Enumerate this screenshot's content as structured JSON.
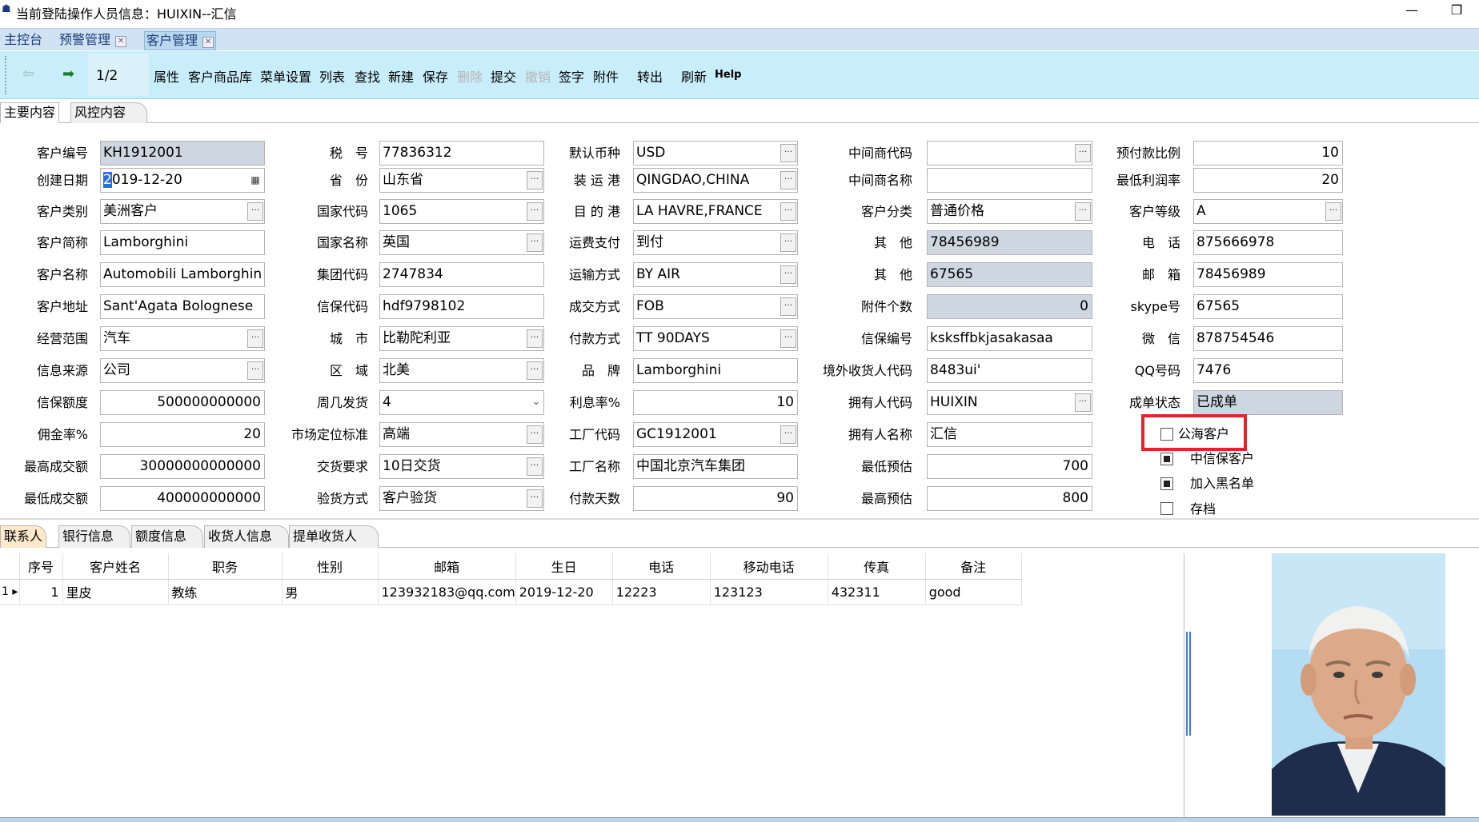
{
  "window": {
    "title": "当前登陆操作人员信息：HUIXIN--汇信",
    "min_glyph": "—",
    "restore_glyph": "❐"
  },
  "tabs": [
    {
      "label": "主控台"
    },
    {
      "label": "预警管理"
    },
    {
      "label": "客户管理"
    }
  ],
  "toolbar": {
    "page": "1/2",
    "buttons": [
      "属性",
      "客户商品库",
      "菜单设置",
      "列表",
      "查找",
      "新建",
      "保存",
      "删除",
      "提交",
      "撤销",
      "签字",
      "附件",
      "转出",
      "刷新",
      "Help"
    ]
  },
  "content_tabs": [
    "主要内容",
    "风控内容"
  ],
  "form": {
    "col1": [
      {
        "label": "客户编号",
        "value": "KH1912001"
      },
      {
        "label": "创建日期",
        "value": "2019-12-20"
      },
      {
        "label": "客户类别",
        "value": "美洲客户"
      },
      {
        "label": "客户简称",
        "value": "Lamborghini"
      },
      {
        "label": "客户名称",
        "value": "Automobili Lamborghini S"
      },
      {
        "label": "客户地址",
        "value": "Sant'Agata Bolognese"
      },
      {
        "label": "经营范围",
        "value": "汽车"
      },
      {
        "label": "信息来源",
        "value": "公司"
      },
      {
        "label": "信保额度",
        "value": "500000000000"
      },
      {
        "label": "佣金率%",
        "value": "20"
      },
      {
        "label": "最高成交额",
        "value": "30000000000000"
      },
      {
        "label": "最低成交额",
        "value": "400000000000"
      }
    ],
    "col2": [
      {
        "label": "税　号",
        "value": "77836312"
      },
      {
        "label": "省　份",
        "value": "山东省"
      },
      {
        "label": "国家代码",
        "value": "1065"
      },
      {
        "label": "国家名称",
        "value": "英国"
      },
      {
        "label": "集团代码",
        "value": "2747834"
      },
      {
        "label": "信保代码",
        "value": "hdf9798102"
      },
      {
        "label": "城　市",
        "value": "比勒陀利亚"
      },
      {
        "label": "区　域",
        "value": "北美"
      },
      {
        "label": "周几发货",
        "value": "4"
      },
      {
        "label": "市场定位标准",
        "value": "高端"
      },
      {
        "label": "交货要求",
        "value": "10日交货"
      },
      {
        "label": "验货方式",
        "value": "客户验货"
      }
    ],
    "col3": [
      {
        "label": "默认币种",
        "value": "USD"
      },
      {
        "label": "装 运 港",
        "value": "QINGDAO,CHINA"
      },
      {
        "label": "目 的 港",
        "value": "LA HAVRE,FRANCE"
      },
      {
        "label": "运费支付",
        "value": "到付"
      },
      {
        "label": "运输方式",
        "value": "BY AIR"
      },
      {
        "label": "成交方式",
        "value": "FOB"
      },
      {
        "label": "付款方式",
        "value": "TT 90DAYS"
      },
      {
        "label": "品　牌",
        "value": "Lamborghini"
      },
      {
        "label": "利息率%",
        "value": "10"
      },
      {
        "label": "工厂代码",
        "value": "GC1912001"
      },
      {
        "label": "工厂名称",
        "value": "中国北京汽车集团"
      },
      {
        "label": "付款天数",
        "value": "90"
      }
    ],
    "col4": [
      {
        "label": "中间商代码",
        "value": ""
      },
      {
        "label": "中间商名称",
        "value": ""
      },
      {
        "label": "客户分类",
        "value": "普通价格"
      },
      {
        "label": "其　他",
        "value": "78456989"
      },
      {
        "label": "其　他",
        "value": "67565"
      },
      {
        "label": "附件个数",
        "value": "0"
      },
      {
        "label": "信保编号",
        "value": "ksksffbkjasakasaa"
      },
      {
        "label": "境外收货人代码",
        "value": "8483ui'"
      },
      {
        "label": "拥有人代码",
        "value": "HUIXIN"
      },
      {
        "label": "拥有人名称",
        "value": "汇信"
      },
      {
        "label": "最低预估",
        "value": "700"
      },
      {
        "label": "最高预估",
        "value": "800"
      }
    ],
    "col5": [
      {
        "label": "预付款比例",
        "value": "10"
      },
      {
        "label": "最低利润率",
        "value": "20"
      },
      {
        "label": "客户等级",
        "value": "A"
      },
      {
        "label": "电　话",
        "value": "875666978"
      },
      {
        "label": "邮　箱",
        "value": "78456989"
      },
      {
        "label": "skype号",
        "value": "67565"
      },
      {
        "label": "微　信",
        "value": "878754546"
      },
      {
        "label": "QQ号码",
        "value": "7476"
      },
      {
        "label": "成单状态",
        "value": "已成单"
      }
    ],
    "checkboxes": [
      {
        "label": "公海客户",
        "checked": false
      },
      {
        "label": "中信保客户",
        "checked": true
      },
      {
        "label": "加入黑名单",
        "checked": true
      },
      {
        "label": "存档",
        "checked": false
      }
    ]
  },
  "bottom_tabs": [
    "联系人",
    "银行信息",
    "额度信息",
    "收货人信息",
    "提单收货人"
  ],
  "contacts": {
    "columns": [
      "序号",
      "客户姓名",
      "职务",
      "性别",
      "邮箱",
      "生日",
      "电话",
      "移动电话",
      "传真",
      "备注"
    ],
    "rows": [
      [
        "1",
        "里皮",
        "教练",
        "男",
        "123932183@qq.com",
        "2019-12-20",
        "12223",
        "123123",
        "432311",
        "good"
      ]
    ]
  }
}
